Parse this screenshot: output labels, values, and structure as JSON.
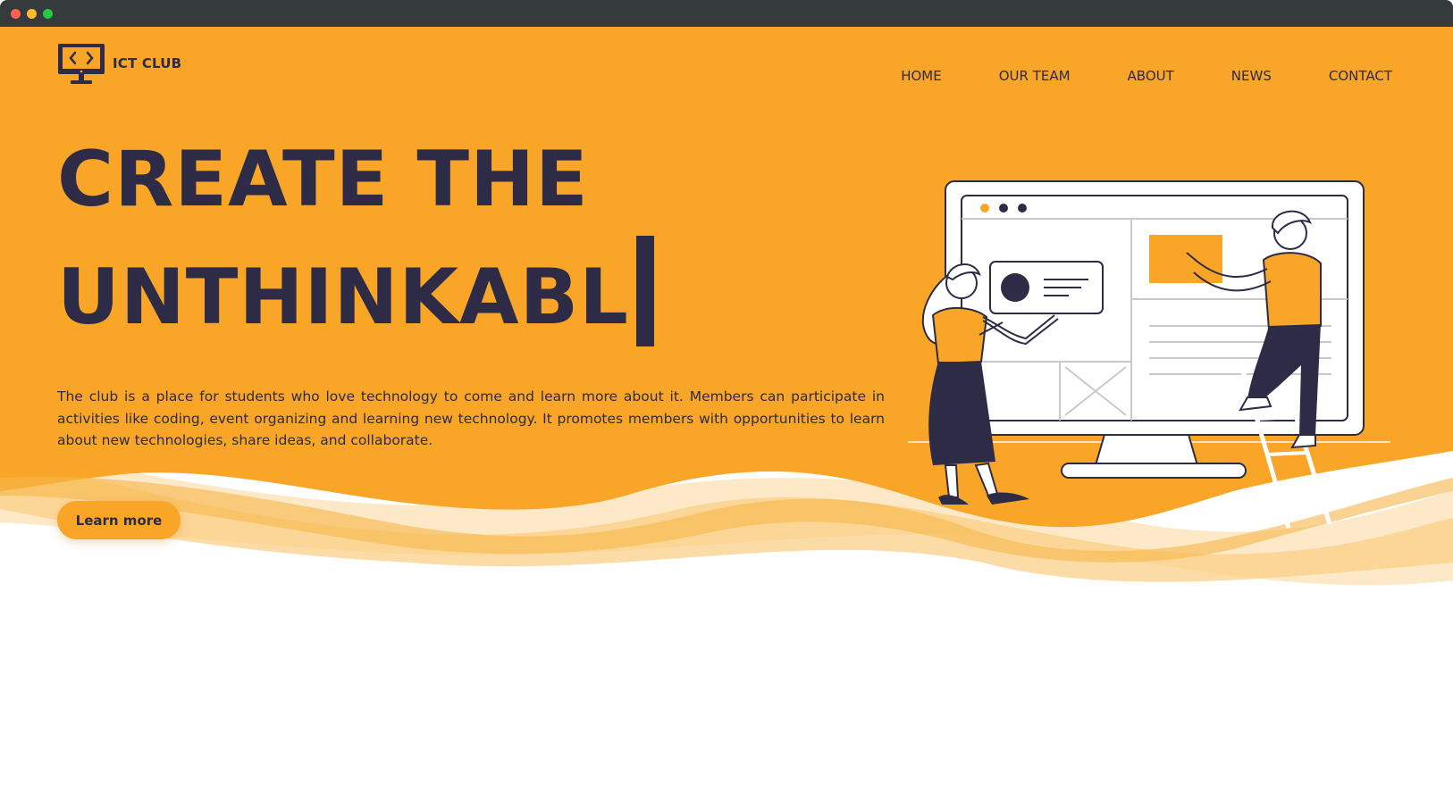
{
  "window": {
    "controls": [
      "close",
      "minimize",
      "maximize"
    ]
  },
  "brand": {
    "name": "ICT CLUB",
    "icon": "monitor-code-icon"
  },
  "nav": {
    "items": [
      {
        "label": "HOME"
      },
      {
        "label": "OUR TEAM"
      },
      {
        "label": "ABOUT"
      },
      {
        "label": "NEWS"
      },
      {
        "label": "CONTACT"
      }
    ]
  },
  "hero": {
    "headline_line1": "CREATE THE",
    "headline_line2": "UNTHINKABL",
    "description": "The club is a place for students who love technology to come and learn more about it. Members can participate in activities like coding, event organizing and learning new technology. It promotes members with opportunities to learn about new technologies, share ideas, and collaborate.",
    "cta_label": "Learn more",
    "illustration": "two-people-building-website-on-monitor"
  },
  "colors": {
    "primary": "#f9a628",
    "dark": "#2d2b45",
    "background": "#ffffff",
    "titlebar": "#353a3d"
  }
}
